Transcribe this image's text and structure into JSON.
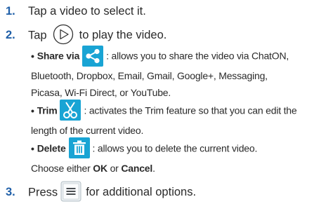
{
  "steps": [
    {
      "num": "1.",
      "text": "Tap a video to select it."
    },
    {
      "num": "2.",
      "pre": "Tap",
      "post": "to play the video."
    },
    {
      "num": "3.",
      "pre": "Press",
      "post": "for additional options."
    }
  ],
  "bullets": {
    "share": {
      "term": "Share via",
      "lines": [
        ": allows you to share the video via ChatON,",
        "Bluetooth, Dropbox, Email, Gmail, Google+, Messaging,",
        "Picasa, Wi-Fi Direct, or YouTube."
      ]
    },
    "trim": {
      "term": "Trim",
      "lines": [
        ": activates the Trim feature so that you can edit the",
        "length of the current video."
      ]
    },
    "delete": {
      "term": "Delete",
      "line1": ": allows you to delete the current video.",
      "choose": "Choose either",
      "ok": "OK",
      "or": "or",
      "cancel": "Cancel",
      "end": "."
    }
  },
  "icons": {
    "play": "play-circle-icon",
    "share": "share-icon",
    "trim": "scissors-icon",
    "delete": "trash-icon",
    "menu": "menu-icon"
  },
  "colors": {
    "accent": "#19a4d4",
    "step_number": "#1f5fa8"
  }
}
